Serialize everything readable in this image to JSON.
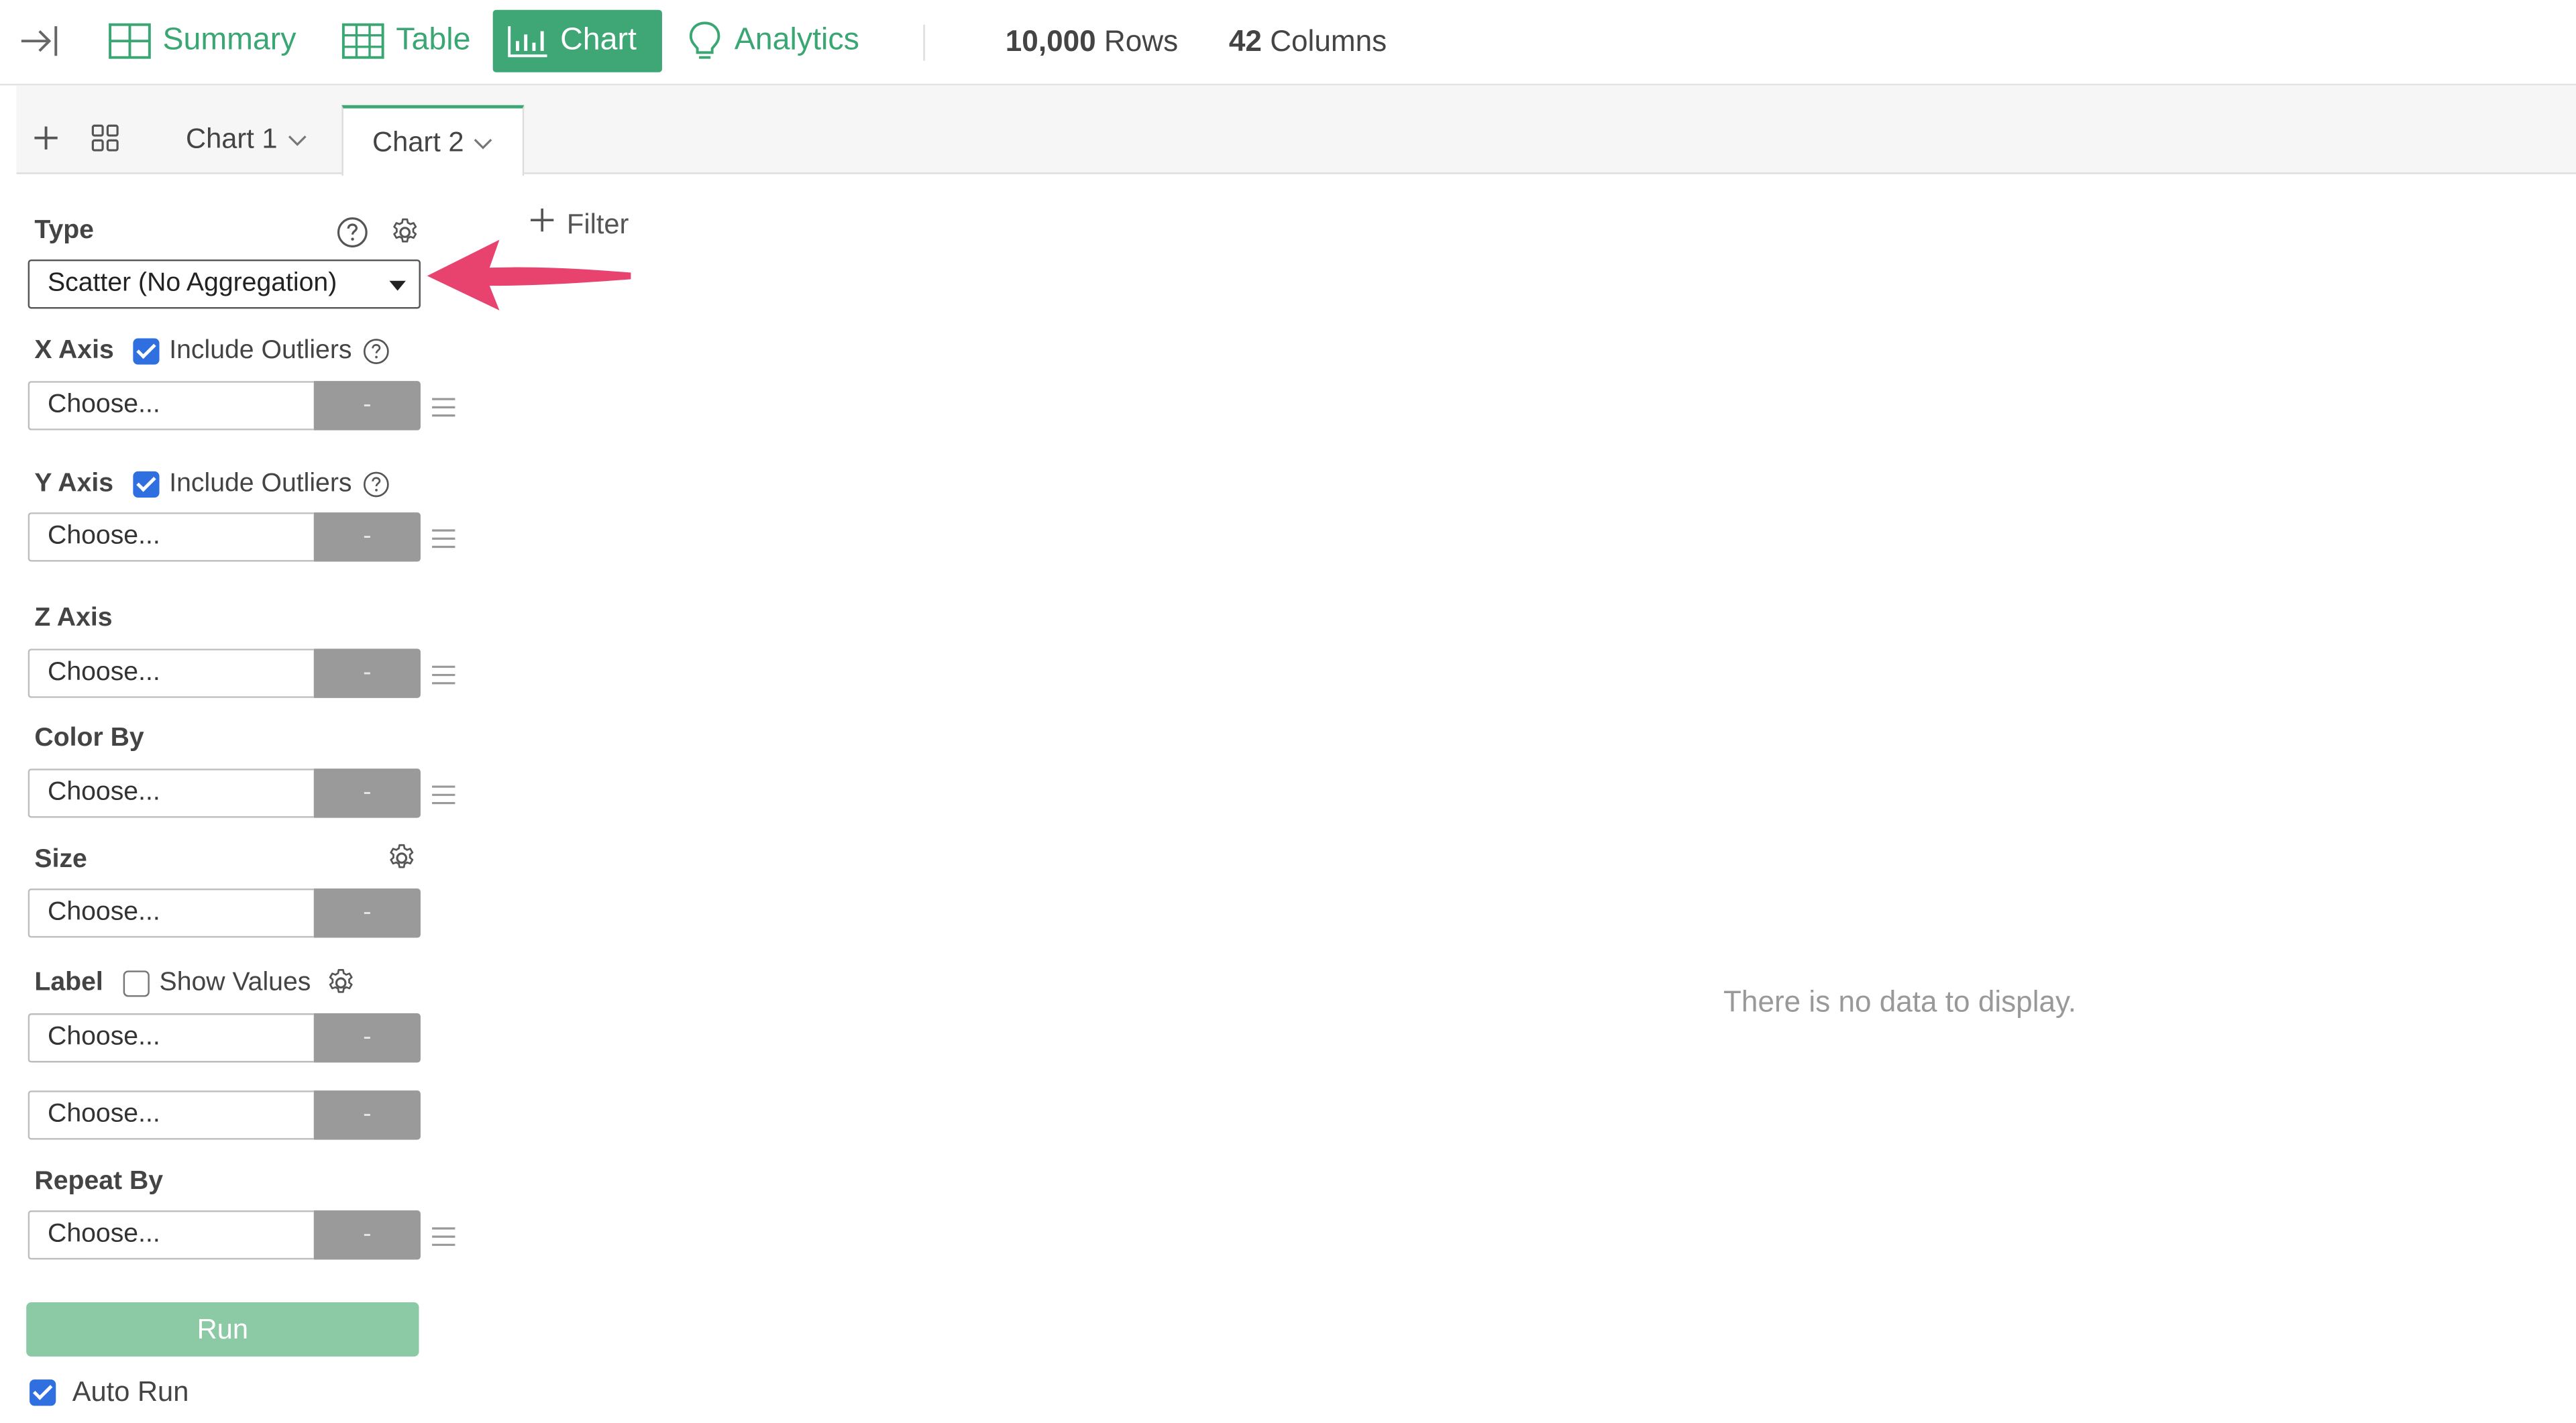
{
  "nav": {
    "summary": "Summary",
    "table": "Table",
    "chart": "Chart",
    "analytics": "Analytics",
    "rows_count": "10,000",
    "rows_label": "Rows",
    "cols_count": "42",
    "cols_label": "Columns"
  },
  "tabs": [
    {
      "label": "Chart 1",
      "active": false
    },
    {
      "label": "Chart 2",
      "active": true
    }
  ],
  "filter_label": "Filter",
  "sidebar": {
    "type_label": "Type",
    "type_value": "Scatter (No Aggregation)",
    "x_axis_label": "X Axis",
    "y_axis_label": "Y Axis",
    "z_axis_label": "Z Axis",
    "color_by_label": "Color By",
    "size_label": "Size",
    "label_label": "Label",
    "repeat_by_label": "Repeat By",
    "include_outliers": "Include Outliers",
    "show_values": "Show Values",
    "choose_placeholder": "Choose...",
    "minus": "-",
    "run": "Run",
    "auto_run": "Auto Run"
  },
  "empty_message": "There is no data to display.",
  "colors": {
    "accent": "#3fa776",
    "run_button": "#8ccaa5",
    "checkbox": "#2f6fe0",
    "annotation_arrow": "#e8436e"
  }
}
